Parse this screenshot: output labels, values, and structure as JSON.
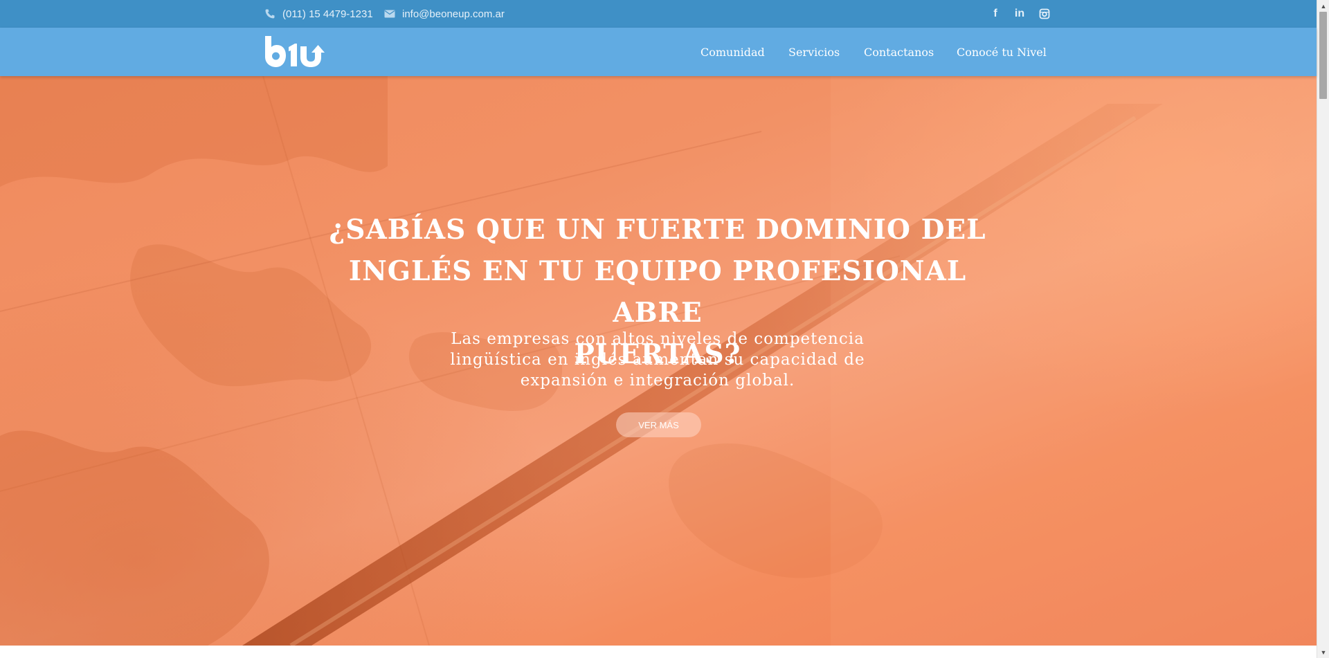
{
  "topbar": {
    "phone": "(011) 15 4479-1231",
    "email": "info@beoneup.com.ar",
    "social": [
      {
        "name": "facebook-icon",
        "glyph": "f"
      },
      {
        "name": "linkedin-icon",
        "glyph": "in"
      },
      {
        "name": "instagram-icon",
        "glyph": ""
      }
    ]
  },
  "navbar": {
    "logo_text": "b1u",
    "items": [
      {
        "label": "Comunidad"
      },
      {
        "label": "Servicios"
      },
      {
        "label": "Contactanos"
      },
      {
        "label": "Conocé tu Nivel"
      }
    ]
  },
  "hero": {
    "title_lines": [
      "¿SABÍAS QUE UN FUERTE DOMINIO DEL",
      "INGLÉS EN TU EQUIPO PROFESIONAL ABRE",
      "PUERTAS?"
    ],
    "subtitle_lines": [
      "Las empresas con altos niveles de competencia",
      "lingüística en inglés aumentan su capacidad de",
      "expansión e integración global."
    ],
    "button_label": "VER MÁS"
  },
  "colors": {
    "topbar_bg": "#3f90c6",
    "navbar_bg": "#61abe2",
    "hero_tint": "#f29165"
  }
}
